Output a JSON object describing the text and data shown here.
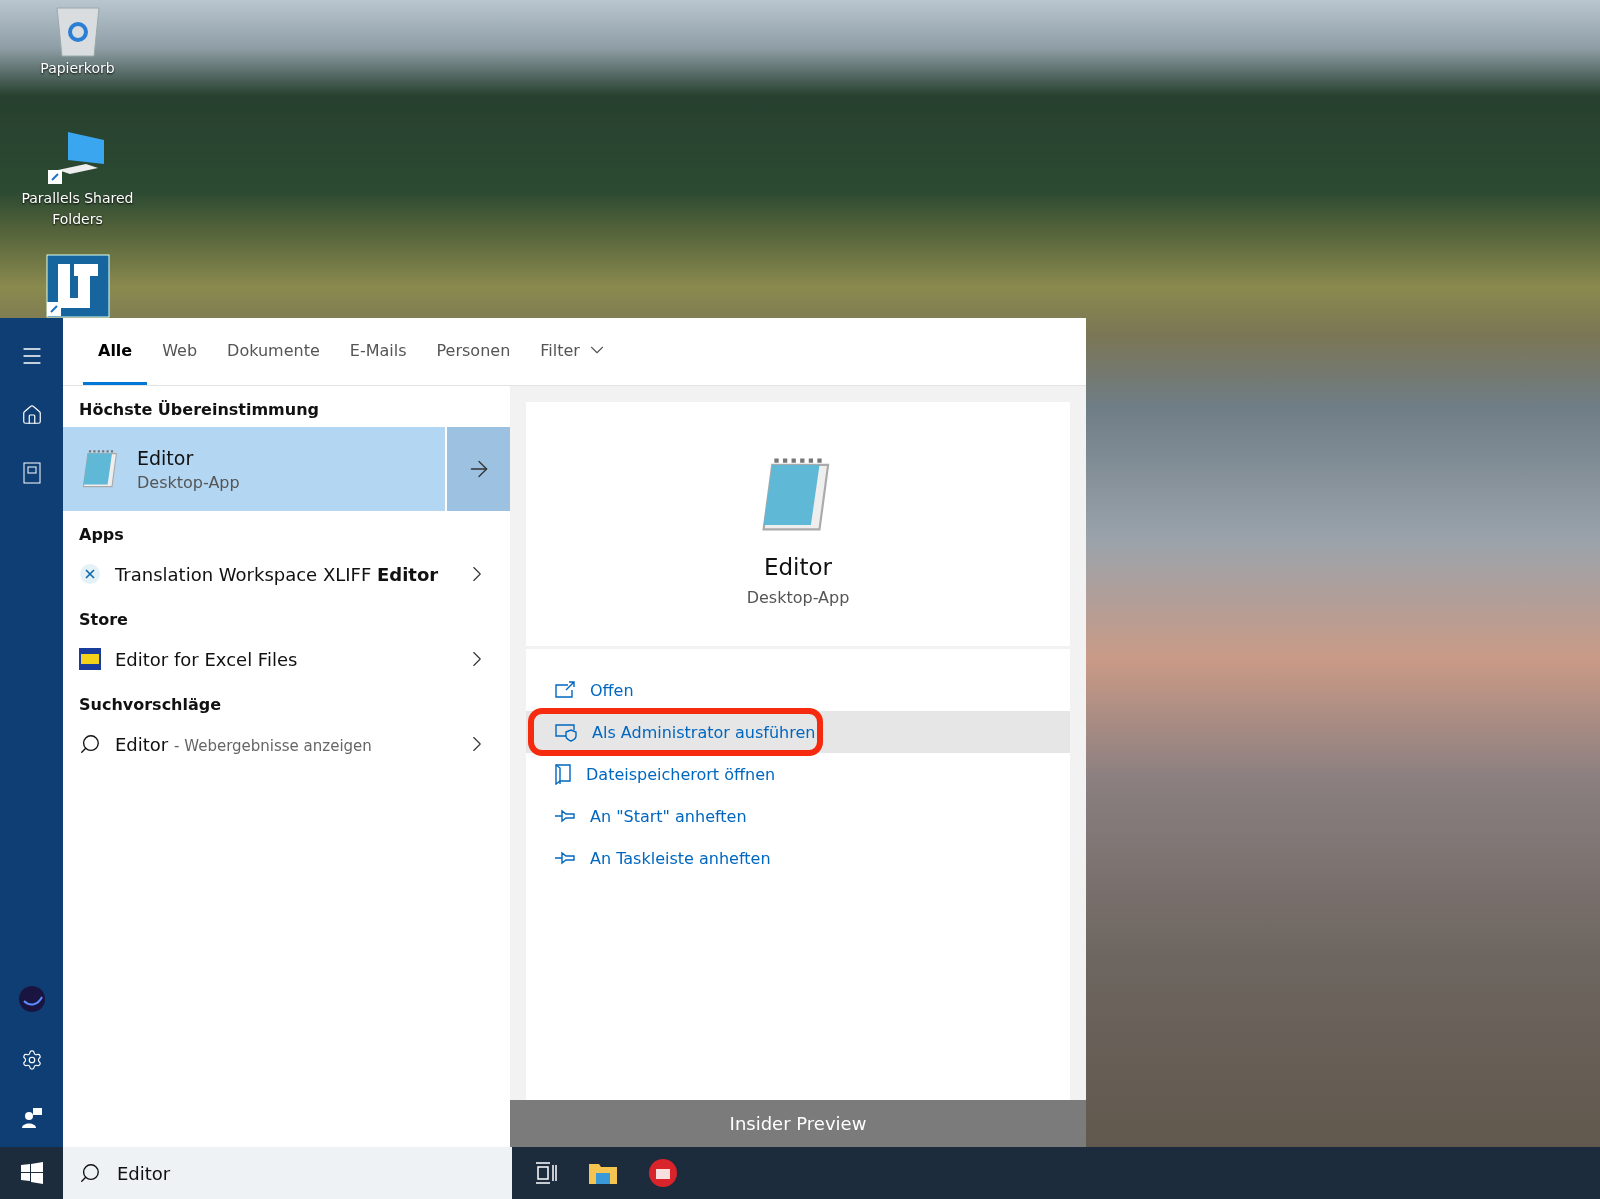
{
  "desktop_icons": [
    {
      "kind": "recycle",
      "label": "Papierkorb"
    },
    {
      "kind": "monitor",
      "label": "Parallels Shared Folders"
    },
    {
      "kind": "app"
    }
  ],
  "tabs": [
    {
      "label": "Alle",
      "selected": true,
      "kind": "tab"
    },
    {
      "label": "Web",
      "selected": false,
      "kind": "tab"
    },
    {
      "label": "Dokumente",
      "selected": false,
      "kind": "tab"
    },
    {
      "label": "E-Mails",
      "selected": false,
      "kind": "tab"
    },
    {
      "label": "Personen",
      "selected": false,
      "kind": "tab"
    },
    {
      "label": "Filter",
      "selected": false,
      "kind": "dropdown"
    }
  ],
  "best_match": {
    "heading": "Höchste Übereinstimmung",
    "title": "Editor",
    "subtitle": "Desktop-App"
  },
  "sections": [
    {
      "heading": "Apps",
      "items": [
        {
          "kind": "xliff",
          "title": "Translation Workspace XLIFF **Editor**"
        }
      ]
    },
    {
      "heading": "Store",
      "items": [
        {
          "kind": "xls",
          "title": "Editor for Excel Files"
        }
      ]
    },
    {
      "heading": "Suchvorschläge",
      "items": [
        {
          "kind": "search",
          "title": "Editor",
          "suffix": "- Webergebnisse anzeigen"
        }
      ]
    }
  ],
  "detail": {
    "title": "Editor",
    "subtitle": "Desktop-App",
    "actions": [
      {
        "kind": "open",
        "label": "Offen",
        "selected": false,
        "highlighted": false
      },
      {
        "kind": "admin",
        "label": "Als Administrator ausführen",
        "selected": true,
        "highlighted": true
      },
      {
        "kind": "folder",
        "label": "Dateispeicherort öffnen",
        "selected": false,
        "highlighted": false
      },
      {
        "kind": "pin",
        "label": "An \"Start\" anheften",
        "selected": false,
        "highlighted": false
      },
      {
        "kind": "pin",
        "label": "An Taskleiste anheften",
        "selected": false,
        "highlighted": false
      }
    ]
  },
  "insider_bar": "Insider Preview",
  "search": {
    "value": "Editor"
  }
}
